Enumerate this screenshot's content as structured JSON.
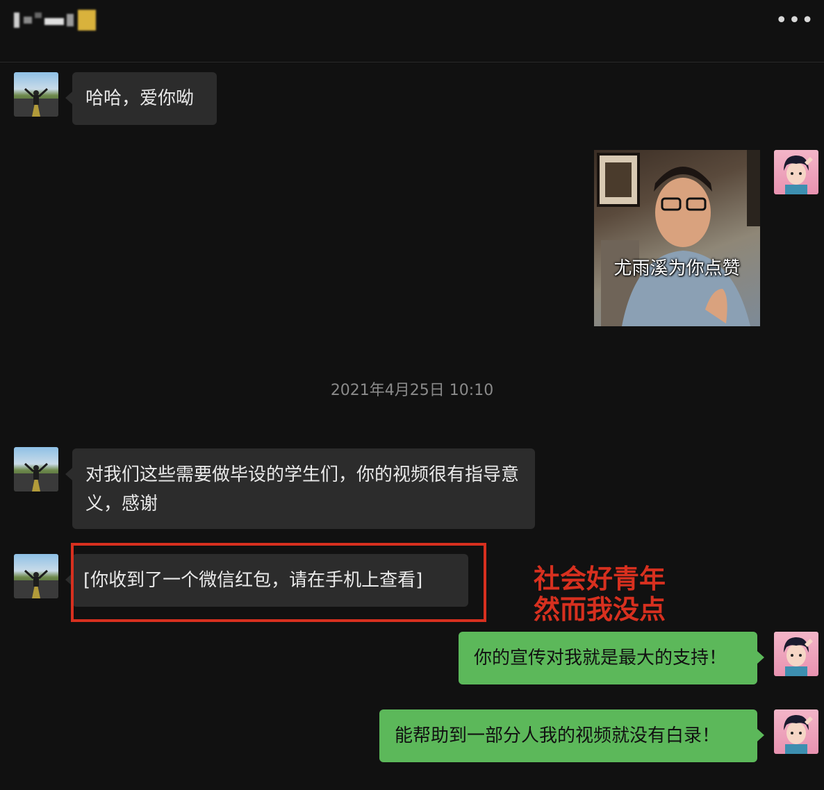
{
  "header": {
    "title_redacted": "",
    "more_label": "•••"
  },
  "messages": [
    {
      "id": "m1",
      "side": "left",
      "text": "哈哈，爱你呦"
    },
    {
      "id": "m2",
      "side": "right",
      "type": "sticker",
      "caption": "尤雨溪为你点赞"
    },
    {
      "id": "m3",
      "side": "left",
      "text": "对我们这些需要做毕设的学生们，你的视频很有指导意义，感谢"
    },
    {
      "id": "m4",
      "side": "left",
      "text": "[你收到了一个微信红包，请在手机上查看]"
    },
    {
      "id": "m5",
      "side": "right",
      "text": "你的宣传对我就是最大的支持！"
    },
    {
      "id": "m6",
      "side": "right",
      "text": "能帮助到一部分人我的视频就没有白录！"
    }
  ],
  "timestamp": "2021年4月25日 10:10",
  "annotation": {
    "text": "社会好青年\n然而我没点",
    "color": "#d7301f"
  },
  "colors": {
    "background": "#111111",
    "incoming_bubble": "#2c2c2c",
    "outgoing_bubble": "#5cb85a"
  }
}
